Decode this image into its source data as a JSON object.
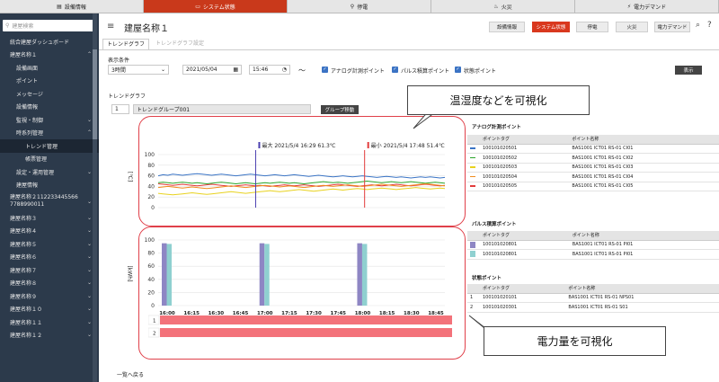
{
  "topnav": [
    {
      "icon": "monitor-icon",
      "glyph": "▤",
      "label": "設備情報",
      "active": false
    },
    {
      "icon": "display-icon",
      "glyph": "▭",
      "label": "システム状態",
      "active": true
    },
    {
      "icon": "power-icon",
      "glyph": "⚲",
      "label": "停電",
      "active": false
    },
    {
      "icon": "fire-icon",
      "glyph": "♨",
      "label": "火災",
      "active": false
    },
    {
      "icon": "plug-icon",
      "glyph": "⚡",
      "label": "電力デマンド",
      "active": false
    }
  ],
  "sidebar": {
    "search_placeholder": "建屋検索",
    "items": [
      {
        "label": "統合建屋ダッシュボード",
        "level": 0,
        "chev": ""
      },
      {
        "label": "建屋名称１",
        "level": 0,
        "chev": "⌃"
      },
      {
        "label": "設備画面",
        "level": 1,
        "chev": ""
      },
      {
        "label": "ポイント",
        "level": 1,
        "chev": ""
      },
      {
        "label": "メッセージ",
        "level": 1,
        "chev": ""
      },
      {
        "label": "設備情報",
        "level": 1,
        "chev": ""
      },
      {
        "label": "監視・制御",
        "level": 1,
        "chev": "⌄"
      },
      {
        "label": "時系列管理",
        "level": 1,
        "chev": "⌃"
      },
      {
        "label": "トレンド管理",
        "level": 2,
        "chev": "",
        "active": true
      },
      {
        "label": "帳票管理",
        "level": 2,
        "chev": ""
      },
      {
        "label": "設定・運用管理",
        "level": 1,
        "chev": "⌄"
      },
      {
        "label": "建屋情報",
        "level": 1,
        "chev": ""
      },
      {
        "label": "建屋名称２112233445566\n7788990011",
        "level": 0,
        "chev": "⌄",
        "two": true
      },
      {
        "label": "建屋名称３",
        "level": 0,
        "chev": "⌄"
      },
      {
        "label": "建屋名称４",
        "level": 0,
        "chev": "⌄"
      },
      {
        "label": "建屋名称５",
        "level": 0,
        "chev": "⌄"
      },
      {
        "label": "建屋名称６",
        "level": 0,
        "chev": "⌄"
      },
      {
        "label": "建屋名称７",
        "level": 0,
        "chev": "⌄"
      },
      {
        "label": "建屋名称８",
        "level": 0,
        "chev": "⌄"
      },
      {
        "label": "建屋名称９",
        "level": 0,
        "chev": "⌄"
      },
      {
        "label": "建屋名称１０",
        "level": 0,
        "chev": "⌄"
      },
      {
        "label": "建屋名称１１",
        "level": 0,
        "chev": "⌄"
      },
      {
        "label": "建屋名称１２",
        "level": 0,
        "chev": "⌄"
      }
    ]
  },
  "header": {
    "title": "建屋名称１",
    "buttons": [
      "設備情報",
      "システム状態",
      "停電",
      "火災",
      "電力デマンド"
    ],
    "active_button": 1
  },
  "tabs": [
    "トレンドグラフ",
    "トレンドグラフ設定"
  ],
  "conditions": {
    "section_label": "表示条件",
    "period": "3時間",
    "date": "2021/05/04",
    "time": "15:46",
    "tilde": "〜",
    "cb1": "アナログ計測ポイント",
    "cb2": "パルス積算ポイント",
    "cb3": "状態ポイント",
    "show_button": "表示"
  },
  "trend": {
    "section_label": "トレンドグラフ",
    "group_no": "1",
    "group_name": "トレンドグループ001",
    "move_button": "グループ移動",
    "max_label": "最大 2021/5/4 16:29 61.3℃",
    "min_label": "最小 2021/5/4 17:48 51.4℃",
    "unit1": "[℃]",
    "unit2": "[kWh]",
    "back_link": "一覧へ戻る"
  },
  "callouts": {
    "top": "温湿度などを可視化",
    "bottom": "電力量を可視化"
  },
  "analog": {
    "title": "アナログ計測ポイント",
    "headers": [
      "ポイントタグ",
      "ポイント名称"
    ],
    "rows": [
      {
        "color": "#3a74c5",
        "tag": "100101020501",
        "name": "BAS1001 ICT01 RS-01 CI01"
      },
      {
        "color": "#2aa52a",
        "tag": "100101020502",
        "name": "BAS1001 ICT01 RS-01 CI02"
      },
      {
        "color": "#e8d21e",
        "tag": "100101020503",
        "name": "BAS1001 ICT01 RS-01 CI03"
      },
      {
        "color": "#f08c1e",
        "tag": "100101020504",
        "name": "BAS1001 ICT01 RS-01 CI04"
      },
      {
        "color": "#e23b3b",
        "tag": "100101020505",
        "name": "BAS1001 ICT01 RS-01 CI05"
      }
    ]
  },
  "pulse": {
    "title": "パルス積算ポイント",
    "headers": [
      "ポイントタグ",
      "ポイント名称"
    ],
    "rows": [
      {
        "color": "#8e86c4",
        "tag": "100101020801",
        "name": "BAS1001 ICT01 RS-01 PI01"
      },
      {
        "color": "#8fd0d0",
        "tag": "100101020801",
        "name": "BAS1001 ICT01 RS-01 PI01"
      }
    ]
  },
  "state": {
    "title": "状態ポイント",
    "headers": [
      "ポイントタグ",
      "ポイント名称"
    ],
    "rows": [
      {
        "no": "1",
        "tag": "100101020101",
        "name": "BAS1001 ICT01 RS-01 NPS01"
      },
      {
        "no": "2",
        "tag": "100101020301",
        "name": "BAS1001 ICT01 RS-01 S01"
      }
    ]
  },
  "chart_data": [
    {
      "type": "line",
      "ylabel": "[℃]",
      "ylim": [
        0,
        100
      ],
      "yticks": [
        0,
        20,
        40,
        60,
        80,
        100
      ],
      "grid": true,
      "series": [
        {
          "color": "#3a74c5",
          "values": [
            60,
            62,
            61,
            63,
            62,
            61,
            62,
            63,
            64,
            63,
            62,
            61,
            62,
            63,
            62,
            61,
            60,
            61,
            62,
            63,
            62,
            61,
            60,
            61,
            62,
            61,
            60,
            61,
            62,
            61,
            60,
            59,
            60,
            61,
            60,
            59,
            58,
            59,
            60,
            59,
            58,
            59,
            60,
            59,
            58,
            57,
            58,
            59,
            58,
            57,
            58,
            57,
            56,
            57,
            58,
            57,
            58,
            57,
            56,
            57
          ]
        },
        {
          "color": "#2aa52a",
          "values": [
            47,
            48,
            47,
            46,
            47,
            48,
            47,
            46,
            47,
            46,
            45,
            46,
            47,
            48,
            47,
            46,
            45,
            46,
            47,
            46,
            45,
            46,
            47,
            46,
            47,
            48,
            47,
            46,
            47,
            46,
            45,
            46,
            47,
            48,
            49,
            48,
            47,
            48,
            47,
            46,
            47,
            48,
            49,
            50,
            49,
            48,
            47,
            48,
            49,
            48,
            47,
            48,
            49,
            48,
            47,
            46,
            47,
            48,
            47,
            46
          ]
        },
        {
          "color": "#e23b3b",
          "values": [
            45,
            44,
            43,
            42,
            43,
            44,
            43,
            42,
            41,
            42,
            43,
            44,
            43,
            42,
            41,
            40,
            41,
            42,
            43,
            42,
            41,
            42,
            41,
            40,
            41,
            42,
            43,
            42,
            41,
            42,
            43,
            42,
            41,
            40,
            41,
            42,
            43,
            44,
            43,
            42,
            41,
            40,
            41,
            42,
            43,
            42,
            41,
            42,
            43,
            44,
            43,
            42,
            41,
            42,
            43,
            44,
            43,
            42,
            41,
            42
          ]
        },
        {
          "color": "#f08c1e",
          "values": [
            38,
            39,
            40,
            39,
            38,
            37,
            38,
            39,
            38,
            37,
            36,
            37,
            38,
            39,
            40,
            41,
            40,
            39,
            38,
            39,
            40,
            41,
            42,
            41,
            40,
            39,
            40,
            41,
            40,
            39,
            38,
            39,
            40,
            41,
            42,
            41,
            40,
            41,
            42,
            43,
            42,
            41,
            40,
            41,
            42,
            43,
            44,
            43,
            42,
            41,
            40,
            41,
            42,
            43,
            44,
            45,
            44,
            43,
            42,
            41
          ]
        },
        {
          "color": "#e8d21e",
          "values": [
            27,
            26,
            25,
            24,
            25,
            26,
            27,
            28,
            27,
            26,
            25,
            26,
            27,
            28,
            29,
            30,
            29,
            28,
            27,
            28,
            29,
            30,
            31,
            32,
            31,
            30,
            31,
            32,
            33,
            34,
            33,
            32,
            31,
            32,
            33,
            34,
            35,
            34,
            33,
            34,
            35,
            36,
            35,
            34,
            35,
            36,
            37,
            36,
            35,
            34,
            35,
            36,
            37,
            38,
            37,
            36,
            35,
            36,
            37,
            36
          ]
        }
      ],
      "markers": [
        {
          "label": "最大 2021/5/4 16:29 61.3℃",
          "color": "#4a3fb0",
          "pos": 0.34
        },
        {
          "label": "最小 2021/5/4 17:48 51.4℃",
          "color": "#e23b3b",
          "pos": 0.72
        }
      ]
    },
    {
      "type": "bar",
      "ylabel": "[kWh]",
      "ylim": [
        0,
        100
      ],
      "yticks": [
        0,
        20,
        40,
        60,
        80,
        100
      ],
      "categories": [
        "16:00",
        "16:15",
        "16:30",
        "16:45",
        "17:00",
        "17:15",
        "17:30",
        "17:45",
        "18:00",
        "18:15",
        "18:30",
        "18:45"
      ],
      "series": [
        {
          "color": "#8e86c4",
          "values": [
            95,
            0,
            0,
            0,
            95,
            0,
            0,
            0,
            95,
            0,
            0,
            0
          ]
        },
        {
          "color": "#8fd0d0",
          "values": [
            94,
            0,
            0,
            0,
            94,
            0,
            0,
            0,
            94,
            0,
            0,
            0
          ]
        }
      ]
    },
    {
      "type": "state",
      "rows": [
        "1",
        "2"
      ],
      "color": "#f3727a"
    }
  ]
}
